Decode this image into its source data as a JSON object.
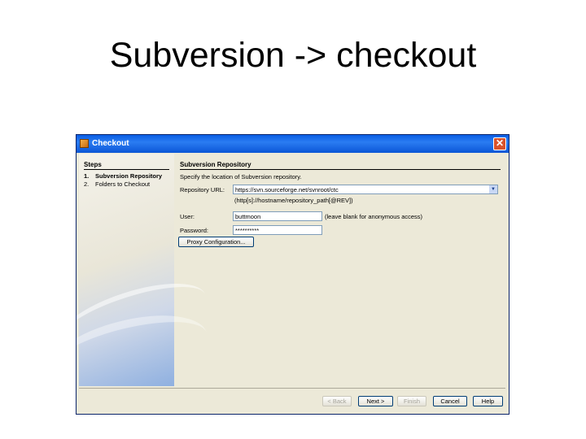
{
  "slide": {
    "title": "Subversion -> checkout"
  },
  "window": {
    "title": "Checkout",
    "close_symbol": "✕"
  },
  "steps": {
    "heading": "Steps",
    "items": [
      {
        "number": "1.",
        "label": "Subversion Repository"
      },
      {
        "number": "2.",
        "label": "Folders to Checkout"
      }
    ]
  },
  "panel": {
    "heading": "Subversion Repository",
    "description": "Specify the location of Subversion repository.",
    "repository_url_label": "Repository URL:",
    "repository_url_value": "https://svn.sourceforge.net/svnroot/ctc",
    "url_hint": "(http[s]://hostname/repository_path[@REV])",
    "user_label": "User:",
    "user_value": "buttmoon",
    "user_note": "(leave blank for anonymous access)",
    "password_label": "Password:",
    "password_value": "**********",
    "proxy_button": "Proxy Configuration..."
  },
  "buttons": {
    "back": "< Back",
    "next": "Next >",
    "finish": "Finish",
    "cancel": "Cancel",
    "help": "Help"
  }
}
